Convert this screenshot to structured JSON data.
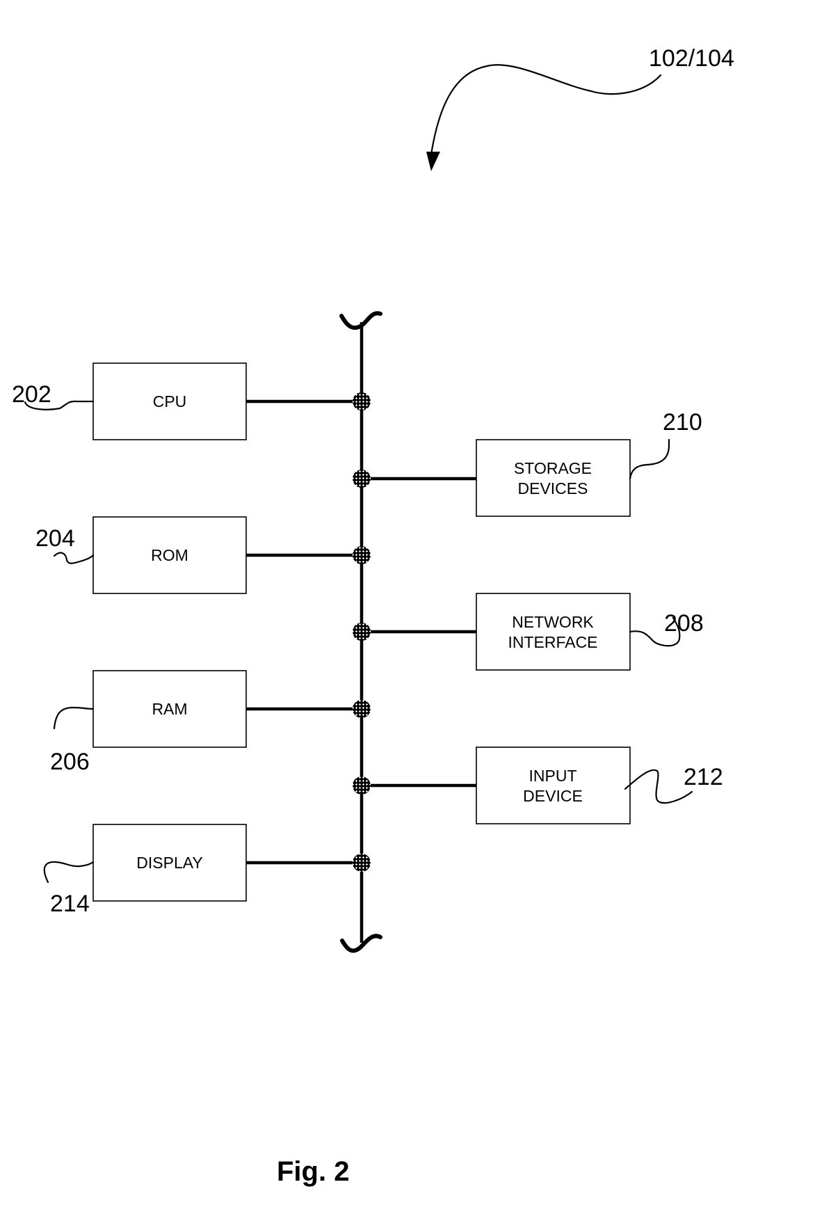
{
  "figure": {
    "caption": "Fig. 2",
    "reference": "102/104"
  },
  "components": {
    "cpu": {
      "label_lines": [
        "CPU"
      ],
      "ref": "202"
    },
    "rom": {
      "label_lines": [
        "ROM"
      ],
      "ref": "204"
    },
    "ram": {
      "label_lines": [
        "RAM"
      ],
      "ref": "206"
    },
    "display": {
      "label_lines": [
        "DISPLAY"
      ],
      "ref": "214"
    },
    "storage": {
      "label_lines": [
        "STORAGE",
        "DEVICES"
      ],
      "ref": "210"
    },
    "network": {
      "label_lines": [
        "NETWORK",
        "INTERFACE"
      ],
      "ref": "208"
    },
    "input": {
      "label_lines": [
        "INPUT",
        "DEVICE"
      ],
      "ref": "212"
    }
  }
}
